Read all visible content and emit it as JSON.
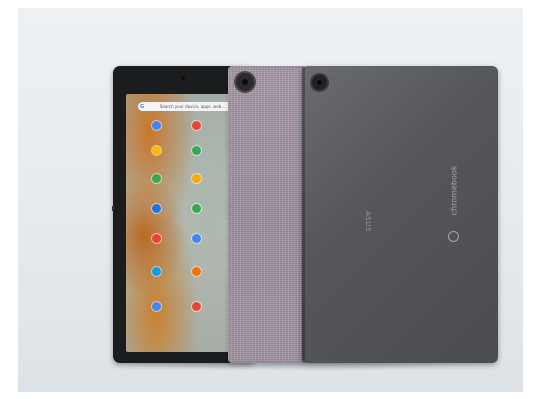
{
  "screen": {
    "search_placeholder": "Search your device, apps, web..."
  },
  "back_panel": {
    "brand_left": "ASUS",
    "brand_right": "chromebook"
  },
  "colors": {
    "tablet_body": "#1b1c1e",
    "fabric_cover": "#a195a3",
    "back_panel": "#55575b",
    "background": "#e9edf0"
  },
  "icons": [
    "google-g-icon",
    "app-icon",
    "chrome-icon",
    "camera-icon"
  ]
}
